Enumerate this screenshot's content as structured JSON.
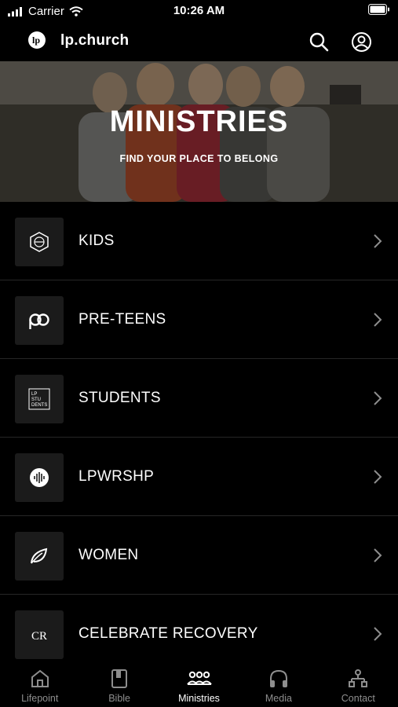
{
  "status_bar": {
    "carrier": "Carrier",
    "time": "10:26 AM"
  },
  "header": {
    "title": "lp.church",
    "logo_icon": "lp-logo-icon",
    "search_icon": "search-icon",
    "profile_icon": "profile-icon"
  },
  "hero": {
    "title": "MINISTRIES",
    "subtitle": "FIND YOUR PLACE TO BELONG"
  },
  "ministries": [
    {
      "label": "KIDS",
      "icon": "kids-badge-icon"
    },
    {
      "label": "PRE-TEENS",
      "icon": "pre-teens-logo-icon"
    },
    {
      "label": "STUDENTS",
      "icon": "students-logo-icon",
      "icon_text": [
        "LP",
        "STU",
        "DENTS"
      ]
    },
    {
      "label": "LPWRSHP",
      "icon": "worship-soundwave-icon"
    },
    {
      "label": "WOMEN",
      "icon": "leaf-icon"
    },
    {
      "label": "CELEBRATE RECOVERY",
      "icon": "cr-monogram-icon",
      "icon_text": "CR"
    }
  ],
  "tabs": [
    {
      "label": "Lifepoint",
      "icon": "home-icon",
      "active": false
    },
    {
      "label": "Bible",
      "icon": "book-icon",
      "active": false
    },
    {
      "label": "Ministries",
      "icon": "group-icon",
      "active": true
    },
    {
      "label": "Media",
      "icon": "headphones-icon",
      "active": false
    },
    {
      "label": "Contact",
      "icon": "org-chart-icon",
      "active": false
    }
  ],
  "colors": {
    "background": "#000000",
    "text": "#ffffff",
    "tab_inactive": "#8e8e8e",
    "icon_box": "#1b1b1b"
  }
}
